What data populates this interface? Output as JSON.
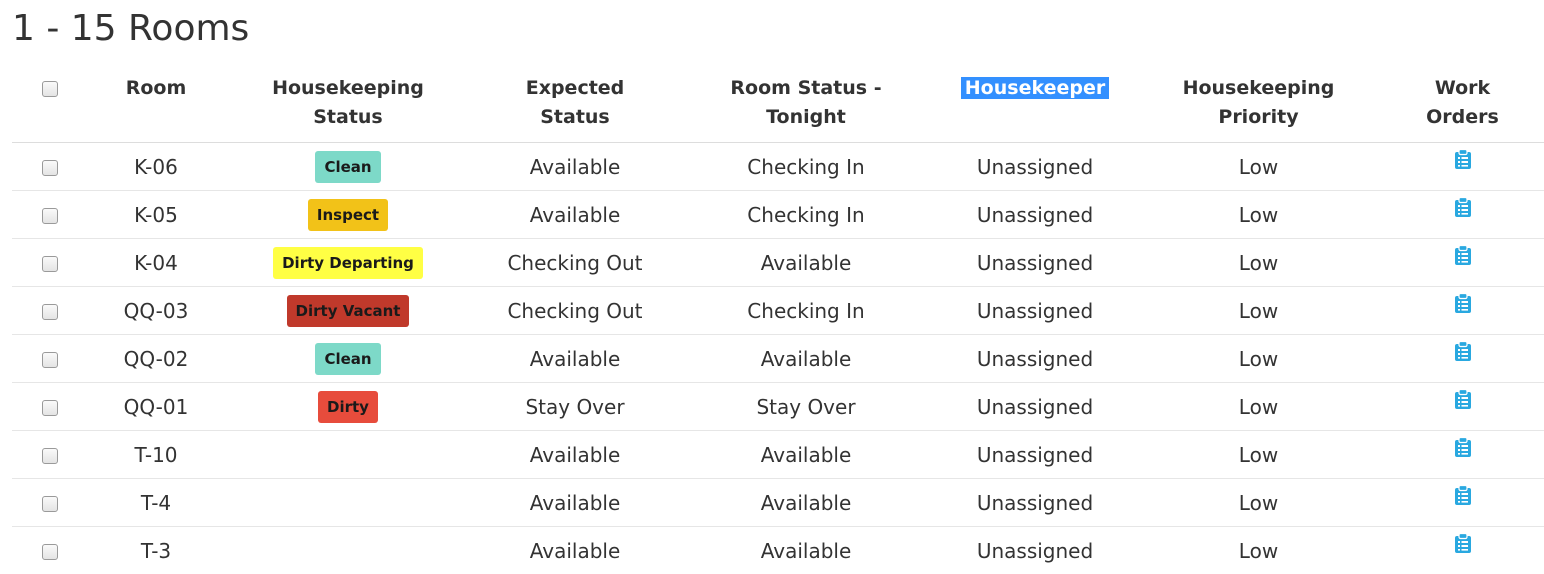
{
  "page_title": "1 - 15 Rooms",
  "columns": {
    "room": "Room",
    "hk_status_line1": "Housekeeping",
    "hk_status_line2": "Status",
    "expected_line1": "Expected",
    "expected_line2": "Status",
    "room_status_line1": "Room Status -",
    "room_status_line2": "Tonight",
    "housekeeper": "Housekeeper",
    "priority_line1": "Housekeeping",
    "priority_line2": "Priority",
    "work_orders_line1": "Work",
    "work_orders_line2": "Orders"
  },
  "status_colors": {
    "Clean": "#7dd9c8",
    "Inspect": "#f2c218",
    "Dirty Departing": "#ffff44",
    "Dirty Vacant": "#c0392b",
    "Dirty": "#e74c3c"
  },
  "work_order_icon": "clipboard-icon",
  "work_order_icon_color": "#29a8e0",
  "rows": [
    {
      "room": "K-06",
      "hk_status": "Clean",
      "expected": "Available",
      "tonight": "Checking In",
      "housekeeper": "Unassigned",
      "priority": "Low"
    },
    {
      "room": "K-05",
      "hk_status": "Inspect",
      "expected": "Available",
      "tonight": "Checking In",
      "housekeeper": "Unassigned",
      "priority": "Low"
    },
    {
      "room": "K-04",
      "hk_status": "Dirty Departing",
      "expected": "Checking Out",
      "tonight": "Available",
      "housekeeper": "Unassigned",
      "priority": "Low"
    },
    {
      "room": "QQ-03",
      "hk_status": "Dirty Vacant",
      "expected": "Checking Out",
      "tonight": "Checking In",
      "housekeeper": "Unassigned",
      "priority": "Low"
    },
    {
      "room": "QQ-02",
      "hk_status": "Clean",
      "expected": "Available",
      "tonight": "Available",
      "housekeeper": "Unassigned",
      "priority": "Low"
    },
    {
      "room": "QQ-01",
      "hk_status": "Dirty",
      "expected": "Stay Over",
      "tonight": "Stay Over",
      "housekeeper": "Unassigned",
      "priority": "Low"
    },
    {
      "room": "T-10",
      "hk_status": "",
      "expected": "Available",
      "tonight": "Available",
      "housekeeper": "Unassigned",
      "priority": "Low"
    },
    {
      "room": "T-4",
      "hk_status": "",
      "expected": "Available",
      "tonight": "Available",
      "housekeeper": "Unassigned",
      "priority": "Low"
    },
    {
      "room": "T-3",
      "hk_status": "",
      "expected": "Available",
      "tonight": "Available",
      "housekeeper": "Unassigned",
      "priority": "Low"
    }
  ]
}
